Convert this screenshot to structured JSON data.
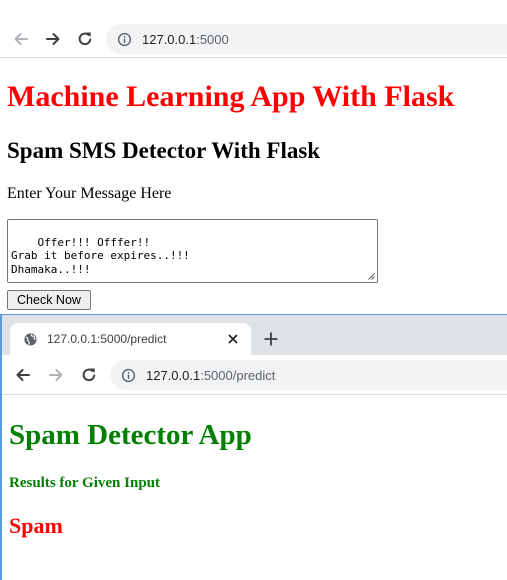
{
  "top_window": {
    "address_bar": {
      "host": "127.0.0.1",
      "rest": ":5000"
    },
    "heading": "Machine Learning App With Flask",
    "subheading": "Spam SMS Detector With Flask",
    "input_label": "Enter Your Message Here",
    "message_text": "Offer!!! Offfer!!\nGrab it before expires..!!!\nDhamaka..!!!",
    "submit_label": "Check Now"
  },
  "bottom_window": {
    "tab": {
      "title": "127.0.0.1:5000/predict"
    },
    "address_bar": {
      "host": "127.0.0.1",
      "rest": ":5000/predict"
    },
    "heading": "Spam Detector App",
    "subheading": "Results for Given Input",
    "result": "Spam"
  },
  "colors": {
    "heading_red": "#ff0000",
    "heading_green": "#008000",
    "result_red": "#ff0000",
    "browser_chrome": "#dee1e6",
    "omnibox_bg": "#f1f3f4"
  },
  "icons": [
    "back-arrow-icon",
    "forward-arrow-icon",
    "reload-icon",
    "info-icon",
    "globe-icon",
    "close-icon",
    "plus-icon"
  ]
}
